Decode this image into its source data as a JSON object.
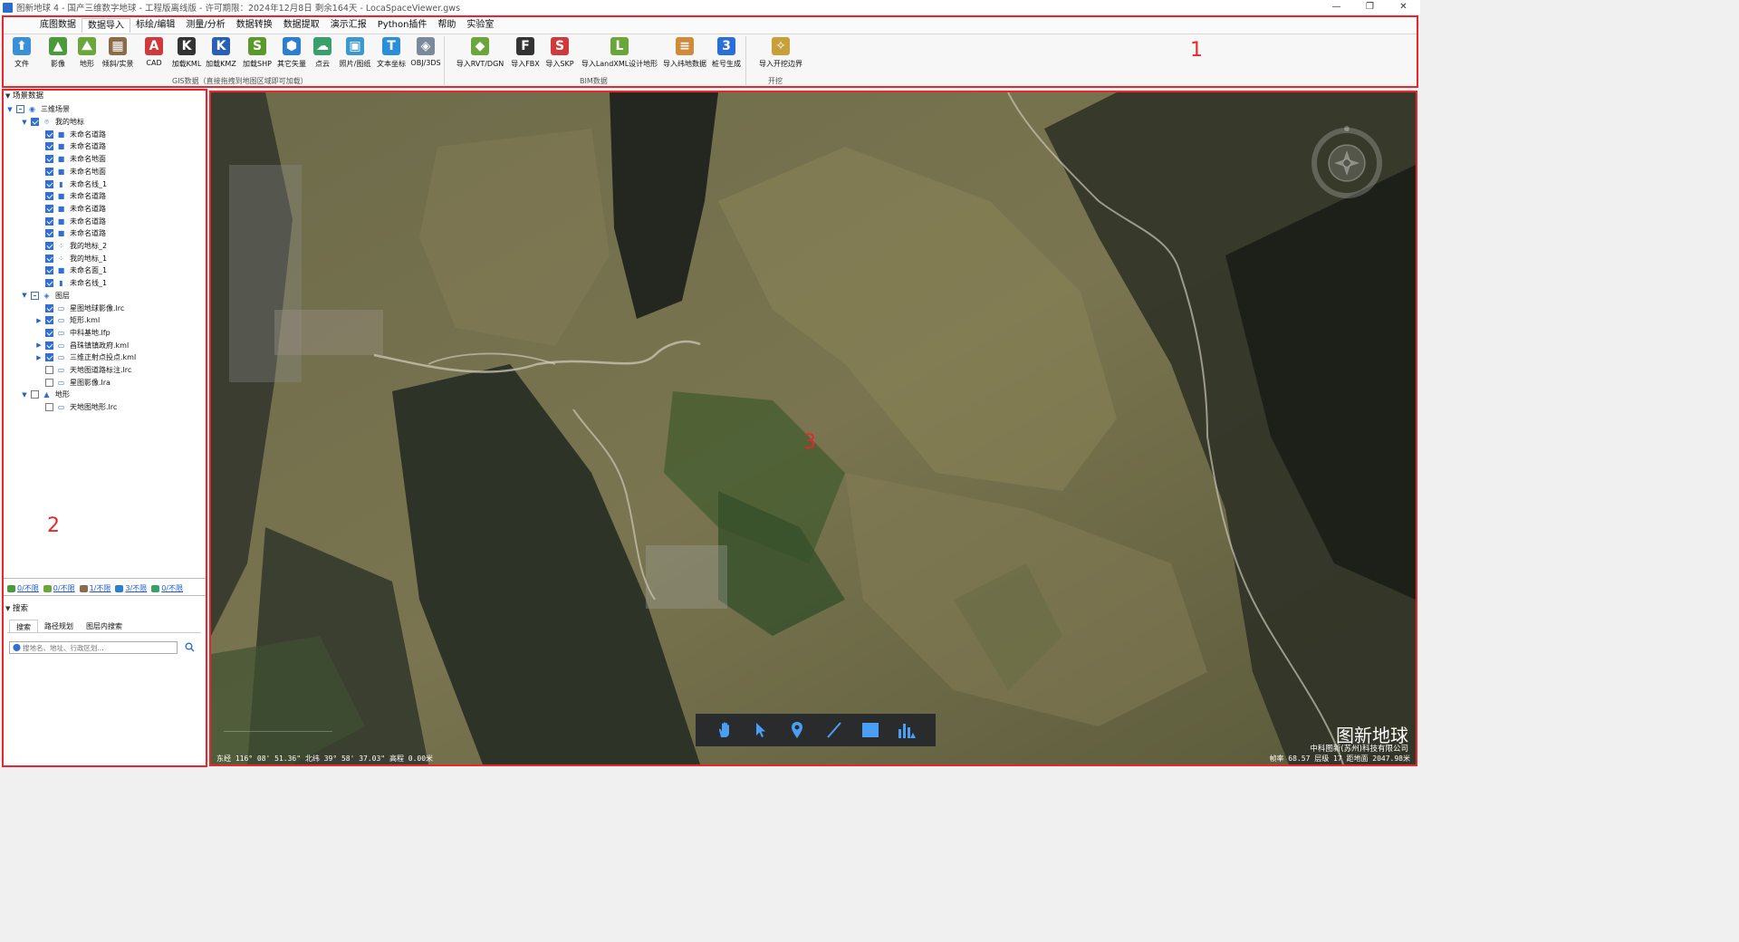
{
  "window": {
    "title": "图新地球 4 - 国产三维数字地球 - 工程版离线版 - 许可期限：2024年12月8日 剩余164天 - LocaSpaceViewer.gws",
    "minimize": "—",
    "restore": "❐",
    "close": "✕"
  },
  "menu": {
    "items": [
      "底图数据",
      "数据导入",
      "标绘/编辑",
      "测量/分析",
      "数据转换",
      "数据提取",
      "演示汇报",
      "Python插件",
      "帮助",
      "实验室"
    ],
    "active_index": 1
  },
  "toolbar": {
    "tools": [
      {
        "label": "文件",
        "icon": "file-icon",
        "color": "#3a8fd8"
      },
      {
        "label": "影像",
        "icon": "imagery-icon",
        "color": "#4a9a3a"
      },
      {
        "label": "地形",
        "icon": "terrain-icon",
        "color": "#6aa63a"
      },
      {
        "label": "倾斜/实景",
        "icon": "oblique-icon",
        "color": "#8a6b4a"
      },
      {
        "label": "CAD",
        "icon": "cad-icon",
        "color": "#d03a3a"
      },
      {
        "label": "加载KML",
        "icon": "kml-icon",
        "color": "#333333"
      },
      {
        "label": "加载KMZ",
        "icon": "kmz-icon",
        "color": "#2a5fb8"
      },
      {
        "label": "加载SHP",
        "icon": "shp-icon",
        "color": "#5a9a2a"
      },
      {
        "label": "其它矢量",
        "icon": "vector-icon",
        "color": "#2a7fd0"
      },
      {
        "label": "点云",
        "icon": "pointcloud-icon",
        "color": "#3aa06a"
      },
      {
        "label": "照片/图纸",
        "icon": "photo-icon",
        "color": "#3a9ad0"
      },
      {
        "label": "文本坐标",
        "icon": "text-coord-icon",
        "color": "#2a8fd8"
      },
      {
        "label": "OBJ/3DS",
        "icon": "obj-icon",
        "color": "#7a8a9a"
      },
      {
        "label": "导入RVT/DGN",
        "icon": "rvt-icon",
        "color": "#6aa63a"
      },
      {
        "label": "导入FBX",
        "icon": "fbx-icon",
        "color": "#333333"
      },
      {
        "label": "导入SKP",
        "icon": "skp-icon",
        "color": "#d03a3a"
      },
      {
        "label": "导入LandXML设计地形",
        "icon": "landxml-icon",
        "color": "#6aa63a"
      },
      {
        "label": "导入纬地数据",
        "icon": "weidi-icon",
        "color": "#d08a3a"
      },
      {
        "label": "桩号生成",
        "icon": "station-icon",
        "color": "#2a6fd8"
      },
      {
        "label": "导入开挖边界",
        "icon": "excavation-icon",
        "color": "#c8a03a"
      }
    ],
    "groups": [
      {
        "label": "GIS数据（直接拖拽到地图区域即可加载）"
      },
      {
        "label": "BIM数据"
      },
      {
        "label": "开挖"
      }
    ],
    "annotation": "1"
  },
  "left_panel": {
    "header": "场景数据",
    "tree": [
      {
        "label": "三维场景",
        "level": 0,
        "expand": "open",
        "check": "part",
        "icon": "globe-icon"
      },
      {
        "label": "我的地标",
        "level": 1,
        "expand": "open",
        "check": "on",
        "icon": "placemark-icon"
      },
      {
        "label": "未命名道路",
        "level": 2,
        "expand": "",
        "check": "on",
        "icon": "square-icon"
      },
      {
        "label": "未命名道路",
        "level": 2,
        "expand": "",
        "check": "on",
        "icon": "square-icon"
      },
      {
        "label": "未命名地面",
        "level": 2,
        "expand": "",
        "check": "on",
        "icon": "square-icon"
      },
      {
        "label": "未命名地面",
        "level": 2,
        "expand": "",
        "check": "on",
        "icon": "square-icon"
      },
      {
        "label": "未命名线_1",
        "level": 2,
        "expand": "",
        "check": "on",
        "icon": "chart-icon"
      },
      {
        "label": "未命名道路",
        "level": 2,
        "expand": "",
        "check": "on",
        "icon": "square-icon"
      },
      {
        "label": "未命名道路",
        "level": 2,
        "expand": "",
        "check": "on",
        "icon": "square-icon"
      },
      {
        "label": "未命名道路",
        "level": 2,
        "expand": "",
        "check": "on",
        "icon": "square-icon"
      },
      {
        "label": "未命名道路",
        "level": 2,
        "expand": "",
        "check": "on",
        "icon": "square-icon"
      },
      {
        "label": "我的地标_2",
        "level": 2,
        "expand": "",
        "check": "on",
        "icon": "points-icon"
      },
      {
        "label": "我的地标_1",
        "level": 2,
        "expand": "",
        "check": "on",
        "icon": "points-icon"
      },
      {
        "label": "未命名面_1",
        "level": 2,
        "expand": "",
        "check": "on",
        "icon": "square-icon"
      },
      {
        "label": "未命名线_1",
        "level": 2,
        "expand": "",
        "check": "on",
        "icon": "chart-icon"
      },
      {
        "label": "图层",
        "level": 1,
        "expand": "open",
        "check": "part",
        "icon": "layers-icon"
      },
      {
        "label": "星图地球影像.lrc",
        "level": 2,
        "expand": "",
        "check": "on",
        "icon": "monitor-icon"
      },
      {
        "label": "矩形.kml",
        "level": 2,
        "expand": "closed",
        "check": "on",
        "icon": "monitor-icon"
      },
      {
        "label": "中科基地.lfp",
        "level": 2,
        "expand": "",
        "check": "on",
        "icon": "monitor-icon"
      },
      {
        "label": "昌珠镇镇政府.kml",
        "level": 2,
        "expand": "closed",
        "check": "on",
        "icon": "monitor-icon"
      },
      {
        "label": "三维正射点投点.kml",
        "level": 2,
        "expand": "closed",
        "check": "on",
        "icon": "monitor-icon"
      },
      {
        "label": "天地图道路标注.lrc",
        "level": 2,
        "expand": "",
        "check": "off",
        "icon": "monitor-icon"
      },
      {
        "label": "星图影像.lra",
        "level": 2,
        "expand": "",
        "check": "off",
        "icon": "monitor-icon"
      },
      {
        "label": "地形",
        "level": 1,
        "expand": "open",
        "check": "off",
        "icon": "terrain-icon"
      },
      {
        "label": "天地图地形.lrc",
        "level": 2,
        "expand": "",
        "check": "off",
        "icon": "monitor-icon"
      }
    ],
    "annotation": "2",
    "stats": [
      {
        "label": "0/不限",
        "icon": "imagery-stat-icon",
        "color": "#4a9a3a"
      },
      {
        "label": "0/不限",
        "icon": "terrain-stat-icon",
        "color": "#6aa63a"
      },
      {
        "label": "1/不限",
        "icon": "oblique-stat-icon",
        "color": "#8a6b4a"
      },
      {
        "label": "3/不限",
        "icon": "vector-stat-icon",
        "color": "#2a7fd0"
      },
      {
        "label": "0/不限",
        "icon": "pointcloud-stat-icon",
        "color": "#3aa06a"
      }
    ],
    "search": {
      "header": "搜索",
      "tabs": [
        "搜索",
        "路径规划",
        "图层内搜索"
      ],
      "active_tab": 0,
      "placeholder": "搜地名、地址、行政区划..."
    }
  },
  "map": {
    "annotation": "3",
    "brand": "图新地球",
    "company": "中科图新(苏州)科技有限公司",
    "status_left": "东经 116° 08' 51.36\" 北纬 39° 58' 37.03\" 高程 0.00米",
    "status_right": "帧率 68.57 层级 17 距地面 2047.98米",
    "tools": [
      "hand-pan-icon",
      "select-arrow-icon",
      "placemark-icon",
      "line-draw-icon",
      "polygon-draw-icon",
      "chart-analysis-icon"
    ]
  }
}
